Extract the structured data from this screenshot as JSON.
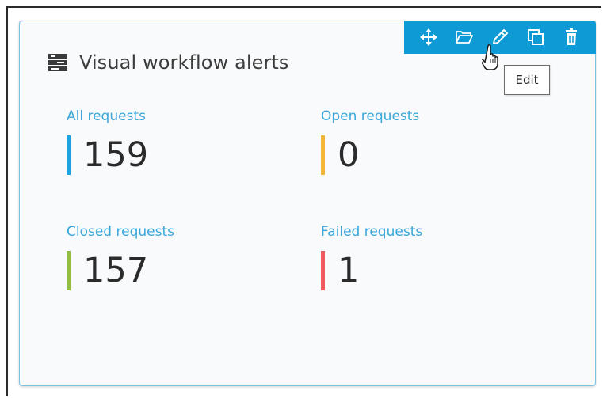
{
  "widget": {
    "title": "Visual workflow alerts",
    "header_icon": "workflow-icon"
  },
  "toolbar": {
    "buttons": [
      {
        "name": "move",
        "icon": "move-icon"
      },
      {
        "name": "open",
        "icon": "folder-open-icon"
      },
      {
        "name": "edit",
        "icon": "pencil-icon"
      },
      {
        "name": "duplicate",
        "icon": "copy-icon"
      },
      {
        "name": "delete",
        "icon": "trash-icon"
      }
    ]
  },
  "tooltip": {
    "text": "Edit"
  },
  "stats": {
    "all": {
      "label": "All requests",
      "value": "159",
      "color": "#1fa3e0"
    },
    "open": {
      "label": "Open requests",
      "value": "0",
      "color": "#f4b43c"
    },
    "closed": {
      "label": "Closed requests",
      "value": "157",
      "color": "#93bd41"
    },
    "failed": {
      "label": "Failed requests",
      "value": "1",
      "color": "#ef5a5d"
    }
  },
  "colors": {
    "accent": "#0e9ad4",
    "label": "#3ba7da",
    "border": "#7cc3e5"
  }
}
